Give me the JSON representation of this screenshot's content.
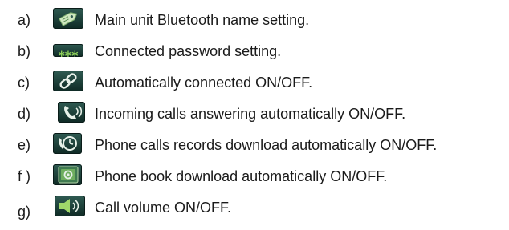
{
  "items": [
    {
      "letter": "a)",
      "icon": "tag-icon",
      "text": "Main unit Bluetooth name setting."
    },
    {
      "letter": "b)",
      "icon": "password-asterisks-icon",
      "text": "Connected password setting."
    },
    {
      "letter": "c)",
      "icon": "chain-link-icon",
      "text": "Automatically connected ON/OFF."
    },
    {
      "letter": "d)",
      "icon": "phone-ringing-icon",
      "text": "Incoming calls answering automatically ON/OFF."
    },
    {
      "letter": "e)",
      "icon": "phone-records-icon",
      "text": "Phone calls records download automatically ON/OFF."
    },
    {
      "letter": "f )",
      "icon": "phone-book-icon",
      "text": "Phone book download automatically ON/OFF."
    },
    {
      "letter": "g)",
      "icon": "speaker-volume-icon",
      "text": "Call volume ON/OFF."
    }
  ]
}
